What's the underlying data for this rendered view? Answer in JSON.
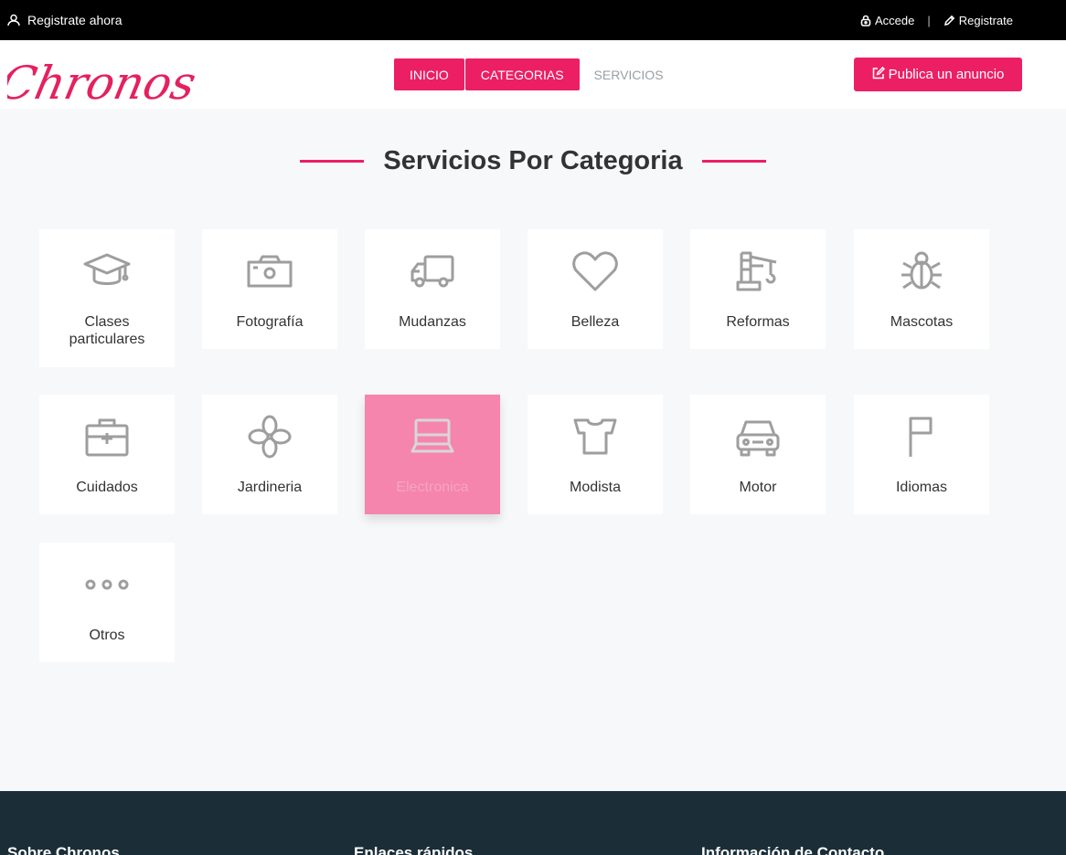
{
  "topbar": {
    "register_now": "Registrate ahora",
    "login": "Accede",
    "separator": "|",
    "register": "Registrate"
  },
  "header": {
    "logo_text": "Chronos",
    "nav": [
      {
        "label": "INICIO",
        "style": "filled"
      },
      {
        "label": "CATEGORIAS",
        "style": "filled"
      },
      {
        "label": "SERVICIOS",
        "style": "plain"
      }
    ],
    "publish_label": "Publica un anuncio"
  },
  "section": {
    "title": "Servicios Por Categoria"
  },
  "categories": [
    {
      "label": "Clases particulares",
      "icon": "graduation-cap-icon"
    },
    {
      "label": "Fotografía",
      "icon": "camera-icon"
    },
    {
      "label": "Mudanzas",
      "icon": "truck-icon"
    },
    {
      "label": "Belleza",
      "icon": "heart-icon"
    },
    {
      "label": "Reformas",
      "icon": "crane-icon"
    },
    {
      "label": "Mascotas",
      "icon": "bug-icon"
    },
    {
      "label": "Cuidados",
      "icon": "first-aid-kit-icon"
    },
    {
      "label": "Jardineria",
      "icon": "flower-icon"
    },
    {
      "label": "Electronica",
      "icon": "laptop-icon",
      "active": true
    },
    {
      "label": "Modista",
      "icon": "shirt-icon"
    },
    {
      "label": "Motor",
      "icon": "car-icon"
    },
    {
      "label": "Idiomas",
      "icon": "flag-icon"
    },
    {
      "label": "Otros",
      "icon": "more-dots-icon"
    }
  ],
  "footer": {
    "col1": "Sobre Chronos",
    "col2": "Enlaces rápidos",
    "col3": "Información de Contacto"
  },
  "colors": {
    "accent": "#ec1f64",
    "active_card": "#f585ac",
    "footer_bg": "#1b2e38",
    "icon_gray": "#9e9e9e"
  }
}
